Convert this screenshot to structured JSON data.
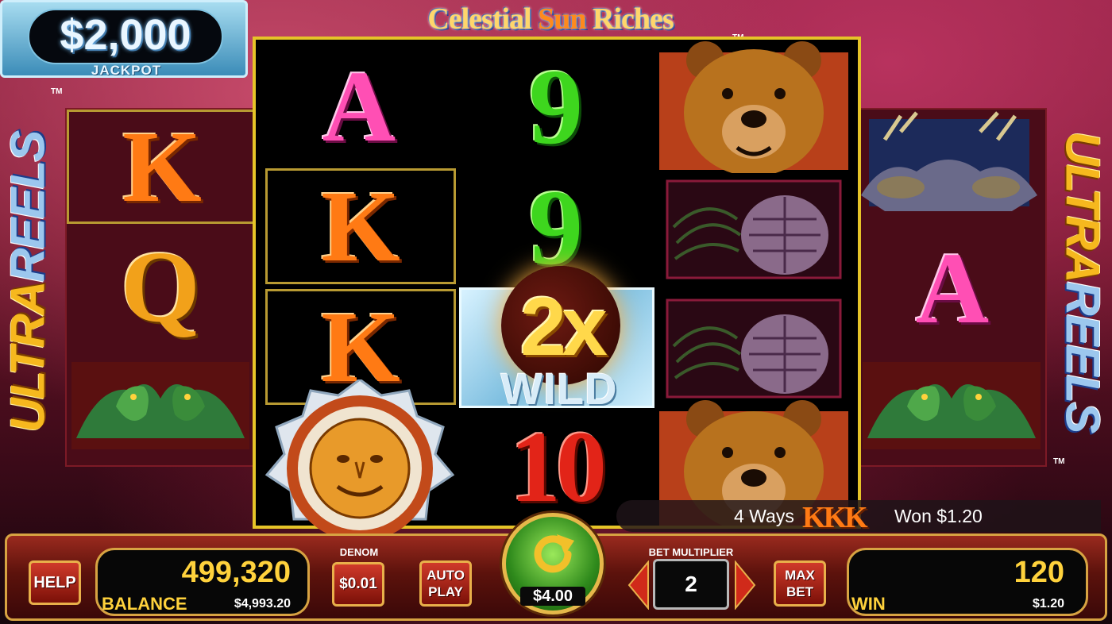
{
  "jackpot": {
    "amount": "$2,000",
    "label": "JACKPOT"
  },
  "title": {
    "word1": "Celestial ",
    "word2": "Sun",
    "word3": " Riches",
    "tm": "TM"
  },
  "side_logo": {
    "word1": "ULTRA",
    "word2": "REELS",
    "tm": "TM"
  },
  "reels": {
    "left": [
      "K",
      "Q",
      "eagle"
    ],
    "reel1": [
      "A",
      "K",
      "K",
      "sun-bonus"
    ],
    "reel2": [
      "9",
      "9",
      "2x WILD",
      "10"
    ],
    "reel3": [
      "bear",
      "pinecone",
      "pinecone",
      "bear"
    ],
    "right": [
      "elk",
      "A",
      "eagle"
    ]
  },
  "wild": {
    "multiplier": "2x",
    "word": "WILD"
  },
  "win_message": {
    "ways": "4 Ways",
    "symbols": "KKK",
    "won": "Won $1.20"
  },
  "controls": {
    "help": "HELP",
    "balance_credits": "499,320",
    "balance_label": "BALANCE",
    "balance_dollars": "$4,993.20",
    "denom_label": "DENOM",
    "denom_value": "$0.01",
    "auto_play_1": "AUTO",
    "auto_play_2": "PLAY",
    "spin_cost": "$4.00",
    "bet_multiplier_label": "BET MULTIPLIER",
    "bet_multiplier_value": "2",
    "max_bet_1": "MAX",
    "max_bet_2": "BET",
    "win_credits": "120",
    "win_label": "WIN",
    "win_dollars": "$1.20"
  },
  "colors": {
    "accent_gold": "#d7a342",
    "reel_frame": "#e6c428",
    "credit_yellow": "#ffd23c"
  }
}
